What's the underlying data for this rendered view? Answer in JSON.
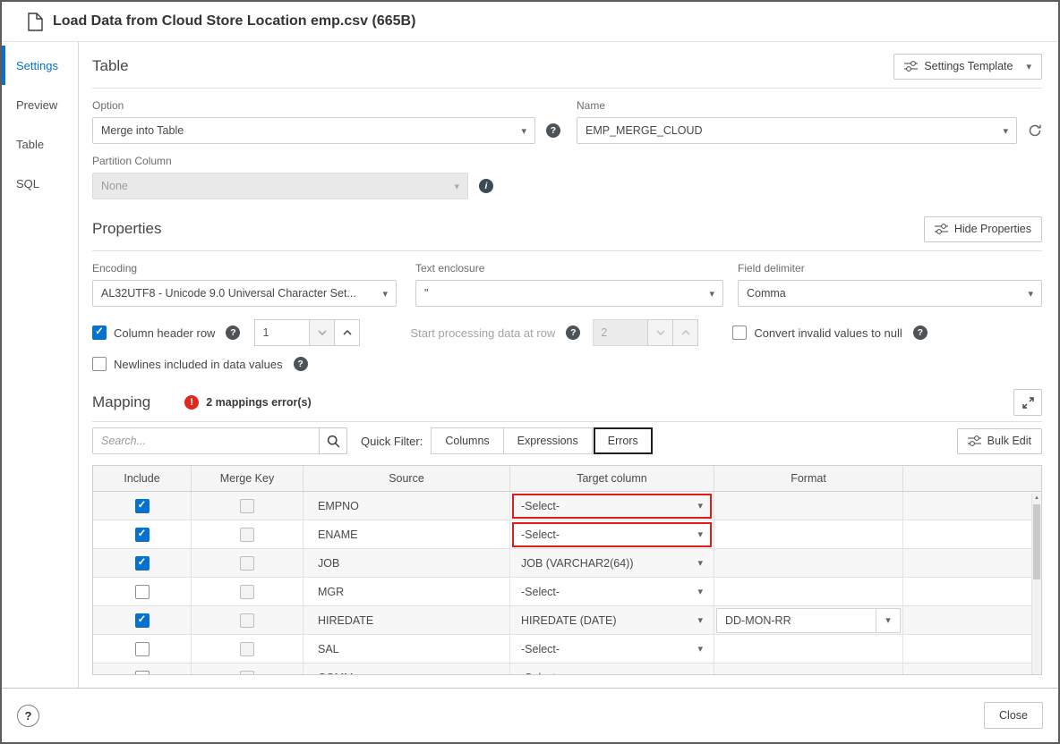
{
  "window": {
    "title": "Load Data from Cloud Store Location emp.csv (665B)"
  },
  "icons": {
    "caret_down": "▾",
    "help_glyph": "?",
    "info_glyph": "i",
    "error_glyph": "!",
    "scroll_up_arrow": "▲"
  },
  "sidebar": {
    "items": [
      {
        "label": "Settings",
        "active": true
      },
      {
        "label": "Preview",
        "active": false
      },
      {
        "label": "Table",
        "active": false
      },
      {
        "label": "SQL",
        "active": false
      }
    ]
  },
  "table_section": {
    "heading": "Table",
    "settings_template_button": "Settings Template",
    "option_label": "Option",
    "option_value": "Merge into Table",
    "name_label": "Name",
    "name_value": "EMP_MERGE_CLOUD",
    "partition_label": "Partition Column",
    "partition_value": "None"
  },
  "properties_section": {
    "heading": "Properties",
    "hide_properties_button": "Hide Properties",
    "encoding_label": "Encoding",
    "encoding_value": "AL32UTF8 - Unicode 9.0 Universal Character Set...",
    "text_enclosure_label": "Text enclosure",
    "text_enclosure_value": "\"",
    "field_delimiter_label": "Field delimiter",
    "field_delimiter_value": "Comma",
    "column_header_row_label": "Column header row",
    "column_header_row_value": "1",
    "start_processing_label": "Start processing data at row",
    "start_processing_value": "2",
    "convert_invalid_label": "Convert invalid values to null",
    "newlines_label": "Newlines included in data values"
  },
  "mapping_section": {
    "heading": "Mapping",
    "errors_text": "2 mappings error(s)",
    "search_placeholder": "Search...",
    "quick_filter_label": "Quick Filter:",
    "filters": [
      {
        "label": "Columns",
        "selected": false
      },
      {
        "label": "Expressions",
        "selected": false
      },
      {
        "label": "Errors",
        "selected": true
      }
    ],
    "bulk_edit_button": "Bulk Edit",
    "table": {
      "headers": [
        "Include",
        "Merge Key",
        "Source",
        "Target column",
        "Format"
      ],
      "rows": [
        {
          "include": true,
          "merge_key": false,
          "source": "EMPNO",
          "target": "-Select-",
          "target_error": true,
          "format": ""
        },
        {
          "include": true,
          "merge_key": false,
          "source": "ENAME",
          "target": "-Select-",
          "target_error": true,
          "format": ""
        },
        {
          "include": true,
          "merge_key": false,
          "source": "JOB",
          "target": "JOB (VARCHAR2(64))",
          "target_error": false,
          "format": ""
        },
        {
          "include": false,
          "merge_key": false,
          "source": "MGR",
          "target": "-Select-",
          "target_error": false,
          "format": ""
        },
        {
          "include": true,
          "merge_key": false,
          "source": "HIREDATE",
          "target": "HIREDATE (DATE)",
          "target_error": false,
          "format": "DD-MON-RR"
        },
        {
          "include": false,
          "merge_key": false,
          "source": "SAL",
          "target": "-Select-",
          "target_error": false,
          "format": ""
        },
        {
          "include": false,
          "merge_key": false,
          "source": "COMM",
          "target": "-Select-",
          "target_error": false,
          "format": ""
        }
      ]
    }
  },
  "footer": {
    "close_button": "Close"
  }
}
